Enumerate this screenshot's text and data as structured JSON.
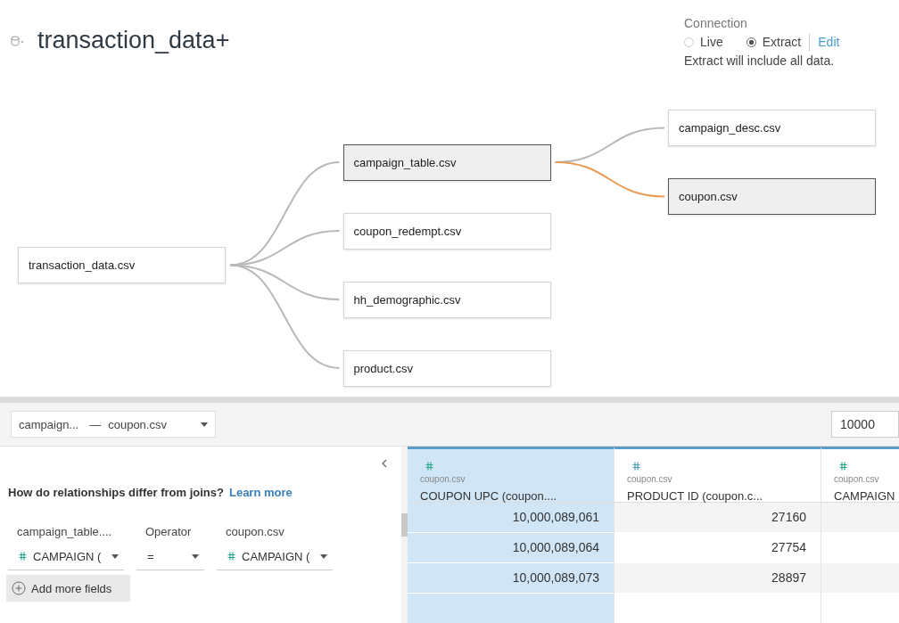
{
  "title": "transaction_data+",
  "connection": {
    "label": "Connection",
    "options": [
      {
        "label": "Live",
        "selected": false
      },
      {
        "label": "Extract",
        "selected": true
      }
    ],
    "edit_link": "Edit",
    "note": "Extract will include all data."
  },
  "diagram": {
    "root": {
      "name": "transaction_data.csv",
      "selected": false,
      "children": [
        {
          "name": "campaign_table.csv",
          "selected": true,
          "children": [
            {
              "name": "campaign_desc.csv",
              "selected": false
            },
            {
              "name": "coupon.csv",
              "selected": true
            }
          ]
        },
        {
          "name": "coupon_redempt.csv",
          "selected": false
        },
        {
          "name": "hh_demographic.csv",
          "selected": false
        },
        {
          "name": "product.csv",
          "selected": false
        }
      ]
    }
  },
  "relationship_picker": {
    "left": "campaign...",
    "separator": "—",
    "right": "coupon.csv"
  },
  "row_limit": "10000",
  "join_panel": {
    "question": "How do relationships differ from joins?",
    "learn_more": "Learn more",
    "columns": [
      {
        "header": "campaign_table....",
        "value": "CAMPAIGN (",
        "kind": "field"
      },
      {
        "header": "Operator",
        "value": "=",
        "kind": "operator"
      },
      {
        "header": "coupon.csv",
        "value": "CAMPAIGN (",
        "kind": "field"
      }
    ],
    "add_button": "Add more fields"
  },
  "grid": {
    "columns": [
      {
        "source": "coupon.csv",
        "name": "COUPON UPC (coupon....",
        "selected": true
      },
      {
        "source": "coupon.csv",
        "name": "PRODUCT ID (coupon.c...",
        "selected": false
      },
      {
        "source": "coupon.csv",
        "name": "CAMPAIGN",
        "selected": false
      }
    ],
    "rows": [
      [
        "10,000,089,061",
        "27160"
      ],
      [
        "10,000,089,064",
        "27754"
      ],
      [
        "10,000,089,073",
        "28897"
      ]
    ]
  }
}
